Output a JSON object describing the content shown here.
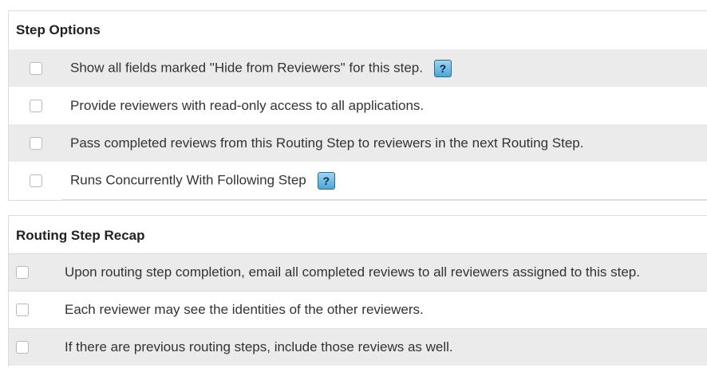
{
  "step_options": {
    "title": "Step Options",
    "items": [
      {
        "label": "Show all fields marked \"Hide from Reviewers\" for this step.",
        "help_icon": "?"
      },
      {
        "label": "Provide reviewers with read-only access to all applications."
      },
      {
        "label": "Pass completed reviews from this Routing Step to reviewers in the next Routing Step."
      },
      {
        "label": "Runs Concurrently With Following Step",
        "help_icon": "?"
      }
    ]
  },
  "routing_step_recap": {
    "title": "Routing Step Recap",
    "items": [
      {
        "label": "Upon routing step completion, email all completed reviews to all reviewers assigned to this step."
      },
      {
        "label": "Each reviewer may see the identities of the other reviewers."
      },
      {
        "label": "If there are previous routing steps, include those reviews as well."
      }
    ]
  },
  "colors": {
    "row_shade": "#ebebeb",
    "border": "#dcdcdc",
    "help_icon_blue": "#4aa7db"
  }
}
